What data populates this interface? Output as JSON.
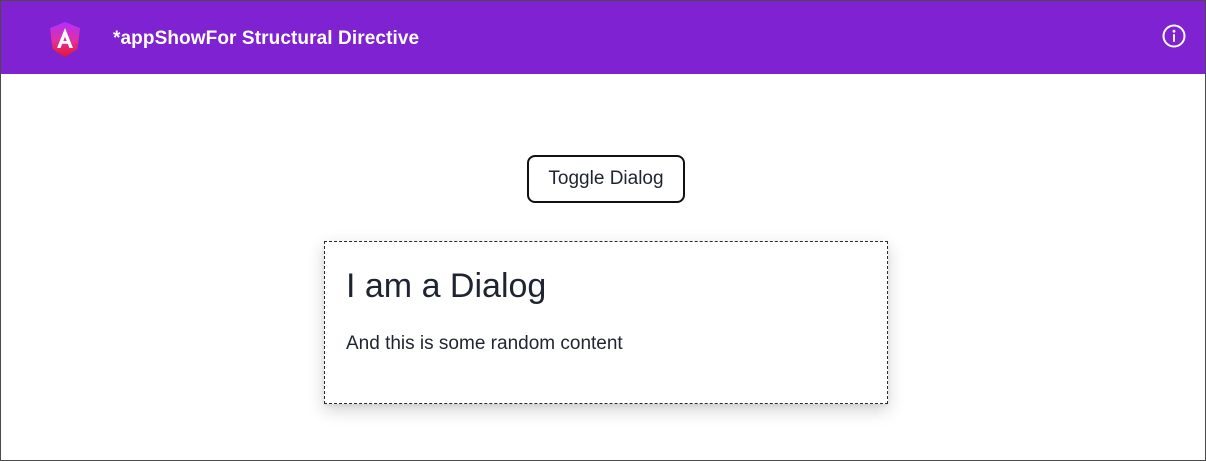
{
  "toolbar": {
    "title": "*appShowFor Structural Directive",
    "background_color": "#7f22d1",
    "logo_icon": "angular-logo-icon",
    "info_icon": "info-circle-icon"
  },
  "main": {
    "toggle_button_label": "Toggle Dialog",
    "dialog": {
      "title": "I am a Dialog",
      "body": "And this is some random content"
    }
  }
}
